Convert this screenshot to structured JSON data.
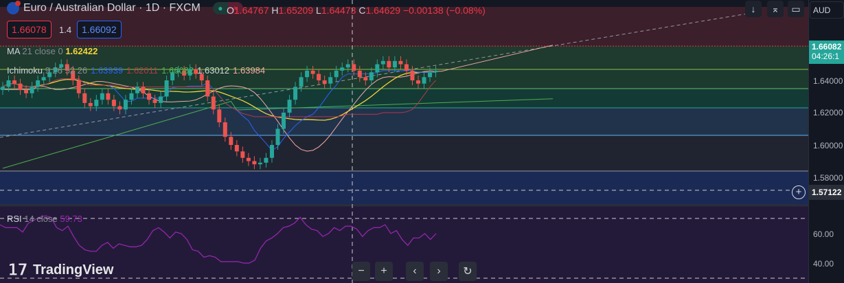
{
  "header": {
    "title": "Euro / Australian Dollar · 1D · FXCM",
    "ohlc": [
      {
        "k": "O",
        "v": "1.64767"
      },
      {
        "k": "H",
        "v": "1.65209"
      },
      {
        "k": "L",
        "v": "1.64473"
      },
      {
        "k": "C",
        "v": "1.64629"
      },
      {
        "k": "",
        "v": "−0.00138 (−0.08%)"
      }
    ],
    "sell_price": "1.66078",
    "spread": "1.4",
    "buy_price": "1.66092",
    "status_icon": "dot",
    "wave_icon": "≈"
  },
  "indicators": {
    "ma": {
      "name": "MA",
      "params": "21 close 0",
      "value": "1.62422"
    },
    "ichimoku": {
      "name": "Ichimoku",
      "params": "9 26 52 26",
      "values": [
        {
          "v": "1.63939",
          "c": "#2962ff"
        },
        {
          "v": "1.62011",
          "c": "#b2384a"
        },
        {
          "v": "1.66082",
          "c": "#4caf50"
        },
        {
          "v": "1.63012",
          "c": "#d1d4dc"
        },
        {
          "v": "1.63984",
          "c": "#f7a9a8"
        }
      ]
    },
    "rsi": {
      "name": "RSI",
      "params": "14 close",
      "value": "59.73"
    }
  },
  "axis": {
    "currency": "AUD",
    "ticks": [
      "1.64000",
      "1.62000",
      "1.60000",
      "1.58000"
    ],
    "last_price": "1.66082",
    "countdown": "04:26:1",
    "crosshair_price": "1.57122",
    "rsi_ticks": [
      "60.00",
      "40.00"
    ]
  },
  "toolbar": {
    "down": "↓",
    "collapse": "⌅",
    "fullscreen": "▭"
  },
  "nav": {
    "zoom_out": "−",
    "zoom_in": "+",
    "left": "‹",
    "right": "›",
    "reset": "↻"
  },
  "brand": "TradingView",
  "colors": {
    "up": "#26a69a",
    "down": "#ef5350",
    "ma": "#f7d33a",
    "rsi": "#9c27b0"
  },
  "chart": {
    "closes": [
      1.636,
      1.64,
      1.638,
      1.634,
      1.632,
      1.636,
      1.64,
      1.642,
      1.645,
      1.648,
      1.65,
      1.646,
      1.64,
      1.632,
      1.626,
      1.624,
      1.628,
      1.632,
      1.628,
      1.624,
      1.622,
      1.628,
      1.632,
      1.636,
      1.632,
      1.628,
      1.626,
      1.63,
      1.64,
      1.645,
      1.646,
      1.643,
      1.647,
      1.644,
      1.64,
      1.63,
      1.622,
      1.614,
      1.605,
      1.6,
      1.596,
      1.592,
      1.59,
      1.588,
      1.589,
      1.592,
      1.6,
      1.61,
      1.62,
      1.628,
      1.636,
      1.642,
      1.646,
      1.644,
      1.64,
      1.638,
      1.642,
      1.646,
      1.648,
      1.65,
      1.646,
      1.642,
      1.64,
      1.645,
      1.65,
      1.652,
      1.648,
      1.652,
      1.65,
      1.646,
      1.64,
      1.638,
      1.642,
      1.645,
      1.646
    ],
    "rsi": [
      66,
      64,
      64,
      64,
      61,
      67,
      69,
      71,
      72,
      71,
      64,
      62,
      65,
      58,
      52,
      49,
      48,
      48,
      52,
      54,
      50,
      53,
      52,
      51,
      51,
      52,
      56,
      62,
      64,
      61,
      57,
      61,
      60,
      56,
      49,
      48,
      44,
      45,
      44,
      41,
      41,
      41,
      41,
      40,
      40,
      42,
      50,
      55,
      57,
      60,
      64,
      65,
      67,
      71,
      66,
      63,
      62,
      58,
      60,
      64,
      62,
      65,
      65,
      63,
      58,
      62,
      64,
      64,
      66,
      60,
      62,
      56,
      52,
      57,
      57,
      60,
      56,
      60
    ]
  }
}
